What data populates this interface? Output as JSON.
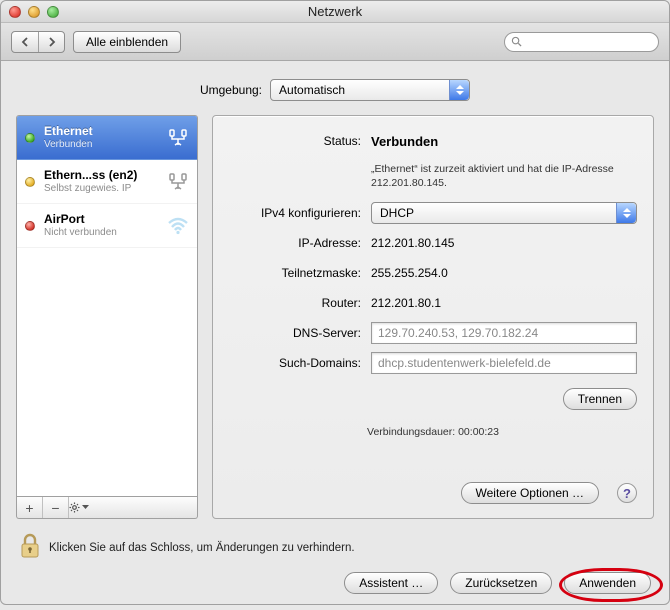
{
  "window": {
    "title": "Netzwerk"
  },
  "toolbar": {
    "show_all": "Alle einblenden",
    "search_placeholder": ""
  },
  "environment": {
    "label": "Umgebung:",
    "value": "Automatisch"
  },
  "sidebar": {
    "items": [
      {
        "name": "Ethernet",
        "status": "Verbunden",
        "dot": "green",
        "icon": "ethernet",
        "selected": true
      },
      {
        "name": "Ethern...ss (en2)",
        "status": "Selbst zugewies. IP",
        "dot": "yellow",
        "icon": "ethernet",
        "selected": false
      },
      {
        "name": "AirPort",
        "status": "Nicht verbunden",
        "dot": "red",
        "icon": "wifi",
        "selected": false
      }
    ]
  },
  "detail": {
    "status_label": "Status:",
    "status_value": "Verbunden",
    "hint": "„Ethernet“ ist zurzeit aktiviert und hat die IP-Adresse 212.201.80.145.",
    "ipv4_label": "IPv4 konfigurieren:",
    "ipv4_value": "DHCP",
    "ip_label": "IP-Adresse:",
    "ip_value": "212.201.80.145",
    "mask_label": "Teilnetzmaske:",
    "mask_value": "255.255.254.0",
    "router_label": "Router:",
    "router_value": "212.201.80.1",
    "dns_label": "DNS-Server:",
    "dns_value": "129.70.240.53, 129.70.182.24",
    "search_label": "Such-Domains:",
    "search_value": "dhcp.studentenwerk-bielefeld.de",
    "disconnect": "Trennen",
    "duration_label": "Verbindungsdauer:",
    "duration_value": "00:00:23",
    "advanced": "Weitere Optionen …"
  },
  "footer": {
    "lock_text": "Klicken Sie auf das Schloss, um Änderungen zu verhindern.",
    "assistant": "Assistent …",
    "revert": "Zurücksetzen",
    "apply": "Anwenden"
  }
}
